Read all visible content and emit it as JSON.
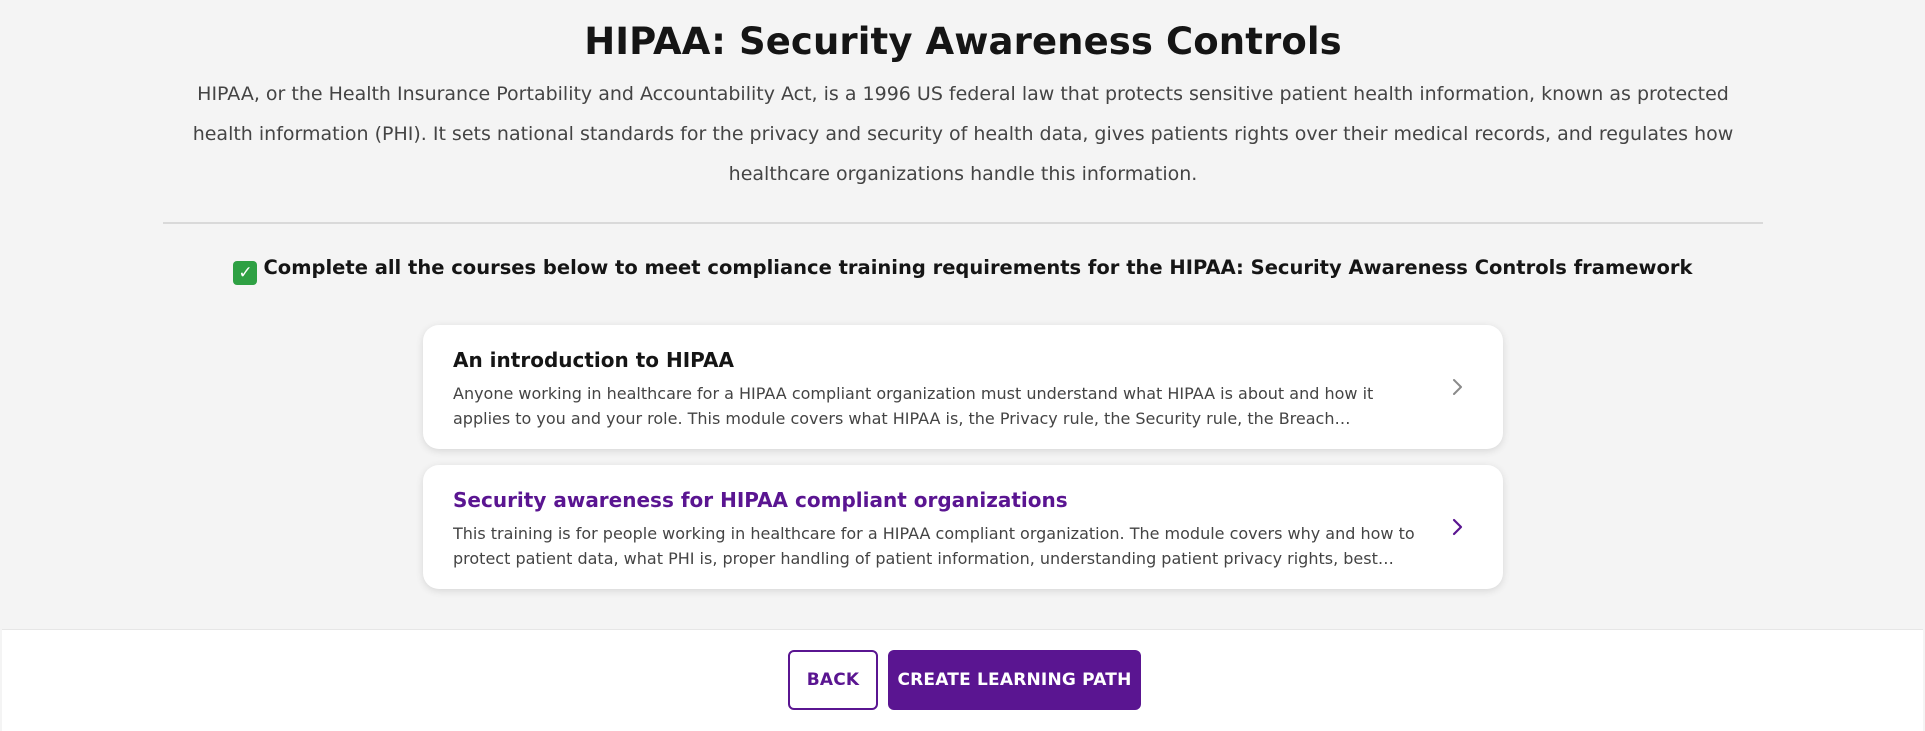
{
  "header": {
    "title": "HIPAA: Security Awareness Controls",
    "description": "HIPAA, or the Health Insurance Portability and Accountability Act, is a 1996 US federal law that protects sensitive patient health information, known as protected health information (PHI). It sets national standards for the privacy and security of health data, gives patients rights over their medical records, and regulates how healthcare organizations handle this information."
  },
  "instruction": {
    "icon": "check-mark-icon",
    "check_glyph": "✓",
    "text": "Complete all the courses below to meet compliance training requirements for the HIPAA: Security Awareness Controls framework"
  },
  "courses": [
    {
      "title": "An introduction to HIPAA",
      "description": "Anyone working in healthcare for a HIPAA compliant organization must understand what HIPAA is about and how it applies to you and your role. This module covers what HIPAA is, the Privacy rule, the Security rule, the Breach notification rule, and how these rules apply to everyday work in healthcare settings."
    },
    {
      "title": "Security awareness for HIPAA compliant organizations",
      "description": "This training is for people working in healthcare for a HIPAA compliant organization. The module covers why and how to protect patient data, what PHI is, proper handling of patient information, understanding patient privacy rights, best practices for safeguarding information and reporting incidents."
    }
  ],
  "footer": {
    "back_label": "BACK",
    "create_label": "CREATE LEARNING PATH"
  },
  "colors": {
    "accent": "#5a1591",
    "check_green": "#2ea043",
    "background": "#f4f4f4"
  }
}
